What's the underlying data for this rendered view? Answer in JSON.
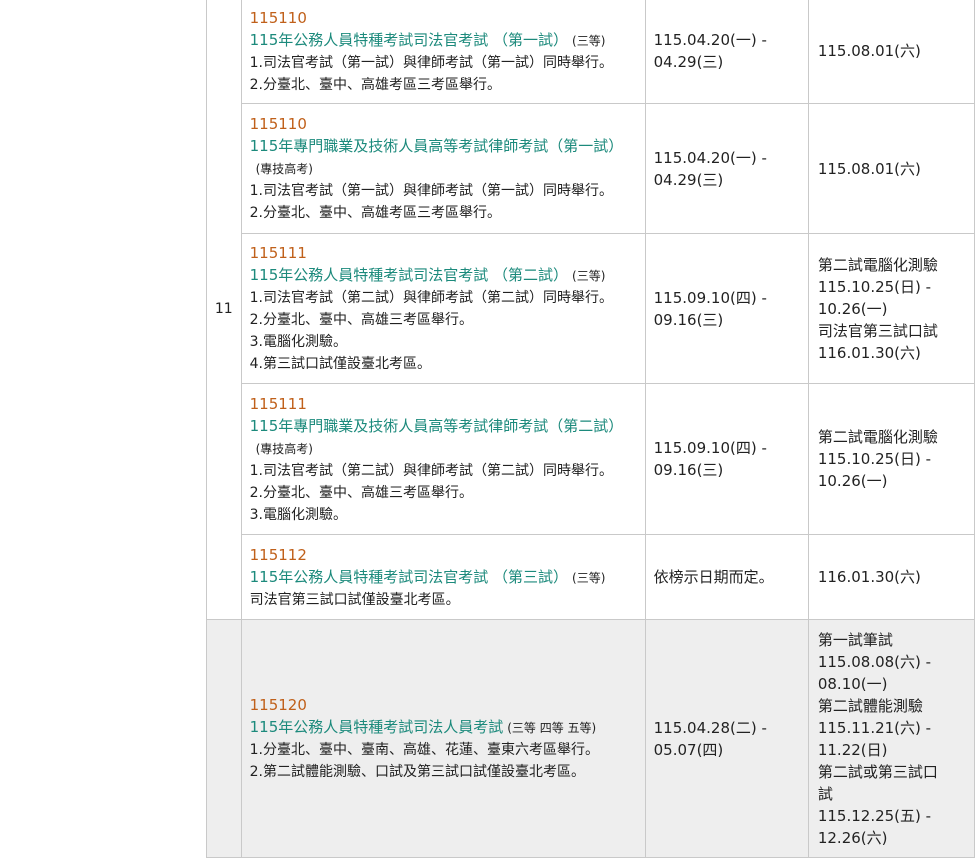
{
  "month": "11",
  "rows": [
    {
      "code": "115110",
      "name": "115年公務人員特種考試司法官考試 （第一試）",
      "level": "(三等)",
      "level_block": "",
      "notes": [
        "1.司法官考試（第一試）與律師考試（第一試）同時舉行。",
        "2.分臺北、臺中、高雄考區三考區舉行。"
      ],
      "date": [
        "115.04.20(一) -",
        "04.29(三)"
      ],
      "result": [
        "115.08.01(六)"
      ]
    },
    {
      "code": "115110",
      "name": "115年專門職業及技術人員高等考試律師考試（第一試）",
      "level": "",
      "level_block": "(專技高考)",
      "notes": [
        "1.司法官考試（第一試）與律師考試（第一試）同時舉行。",
        "2.分臺北、臺中、高雄考區三考區舉行。"
      ],
      "date": [
        "115.04.20(一) -",
        "04.29(三)"
      ],
      "result": [
        "115.08.01(六)"
      ]
    },
    {
      "code": "115111",
      "name": "115年公務人員特種考試司法官考試 （第二試）",
      "level": "(三等)",
      "level_block": "",
      "notes": [
        "1.司法官考試（第二試）與律師考試（第二試）同時舉行。",
        "2.分臺北、臺中、高雄三考區舉行。",
        "3.電腦化測驗。",
        "4.第三試口試僅設臺北考區。"
      ],
      "date": [
        "115.09.10(四) -",
        "09.16(三)"
      ],
      "result": [
        "第二試電腦化測驗",
        "115.10.25(日) -",
        "10.26(一)",
        "司法官第三試口試",
        "116.01.30(六)"
      ]
    },
    {
      "code": "115111",
      "name": "115年專門職業及技術人員高等考試律師考試（第二試）",
      "level": "",
      "level_block": "(專技高考)",
      "notes": [
        "1.司法官考試（第二試）與律師考試（第二試）同時舉行。",
        "2.分臺北、臺中、高雄三考區舉行。",
        "3.電腦化測驗。"
      ],
      "date": [
        "115.09.10(四) -",
        "09.16(三)"
      ],
      "result": [
        "第二試電腦化測驗",
        "115.10.25(日) -",
        "10.26(一)"
      ]
    },
    {
      "code": "115112",
      "name": "115年公務人員特種考試司法官考試 （第三試）",
      "level": "(三等)",
      "level_block": "",
      "notes": [
        "司法官第三試口試僅設臺北考區。"
      ],
      "date": [
        "依榜示日期而定。"
      ],
      "result": [
        "116.01.30(六)"
      ]
    },
    {
      "code": "115120",
      "name": "115年公務人員特種考試司法人員考試",
      "level": "(三等 四等 五等)",
      "level_block": "",
      "notes": [
        "1.分臺北、臺中、臺南、高雄、花蓮、臺東六考區舉行。",
        "2.第二試體能測驗、口試及第三試口試僅設臺北考區。"
      ],
      "date": [
        "115.04.28(二) -",
        "05.07(四)"
      ],
      "result": [
        "第一試筆試",
        "115.08.08(六) -",
        "08.10(一)",
        "第二試體能測驗",
        "115.11.21(六) -",
        "11.22(日)",
        "第二試或第三試口",
        "試",
        "115.12.25(五) -",
        "12.26(六)"
      ]
    }
  ]
}
